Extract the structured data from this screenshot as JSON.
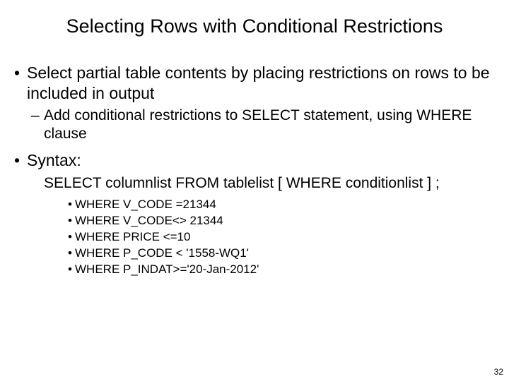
{
  "title": "Selecting Rows with Conditional Restrictions",
  "bullets": {
    "b1": "Select partial table contents by placing restrictions on rows to be included in output",
    "b1_sub": "Add conditional restrictions to SELECT statement, using WHERE clause",
    "b2": "Syntax:",
    "syntax": "SELECT columnlist FROM tablelist [ WHERE conditionlist ] ;",
    "where": [
      "WHERE V_CODE =21344",
      "WHERE V_CODE<> 21344",
      "WHERE PRICE <=10",
      "WHERE P_CODE < '1558-WQ1'",
      "WHERE P_INDAT>='20-Jan-2012'"
    ]
  },
  "page_number": "32"
}
